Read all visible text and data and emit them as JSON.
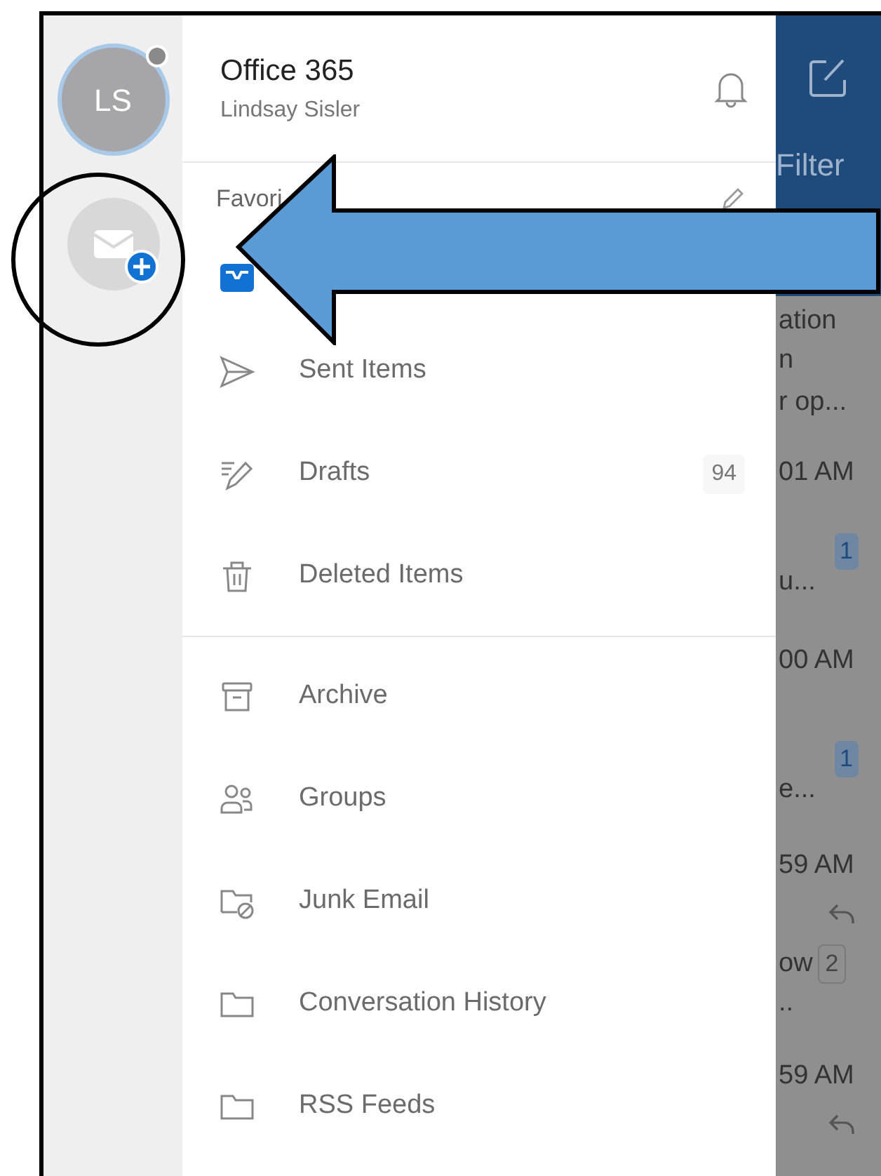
{
  "accounts_rail": {
    "avatar_initials": "LS",
    "add_account": true
  },
  "drawer": {
    "account_title": "Office 365",
    "account_user": "Lindsay Sisler",
    "section_title": "Favori",
    "folders": [
      {
        "kind": "inbox"
      },
      {
        "kind": "sent",
        "label": "Sent Items"
      },
      {
        "kind": "drafts",
        "label": "Drafts",
        "count": "94"
      },
      {
        "kind": "deleted",
        "label": "Deleted Items"
      },
      {
        "kind": "divider"
      },
      {
        "kind": "archive",
        "label": "Archive"
      },
      {
        "kind": "groups",
        "label": "Groups"
      },
      {
        "kind": "junk",
        "label": "Junk Email"
      },
      {
        "kind": "folder",
        "label": "Conversation History"
      },
      {
        "kind": "folder",
        "label": "RSS Feeds"
      }
    ]
  },
  "background_list": {
    "filter_label": "Filter",
    "fragments": [
      {
        "kind": "text",
        "text": "ation"
      },
      {
        "kind": "text",
        "text": "n"
      },
      {
        "kind": "text",
        "text": "r op..."
      },
      {
        "kind": "text",
        "text": "01 AM"
      },
      {
        "kind": "badge",
        "text": "1"
      },
      {
        "kind": "text",
        "text": "u..."
      },
      {
        "kind": "text",
        "text": "00 AM"
      },
      {
        "kind": "badge",
        "text": "1"
      },
      {
        "kind": "text",
        "text": "e..."
      },
      {
        "kind": "text",
        "text": "59 AM"
      },
      {
        "kind": "reply"
      },
      {
        "kind": "text_badge",
        "text": "ow",
        "badge": "2"
      },
      {
        "kind": "text",
        "text": ".."
      },
      {
        "kind": "text",
        "text": "59 AM"
      },
      {
        "kind": "reply"
      }
    ]
  }
}
